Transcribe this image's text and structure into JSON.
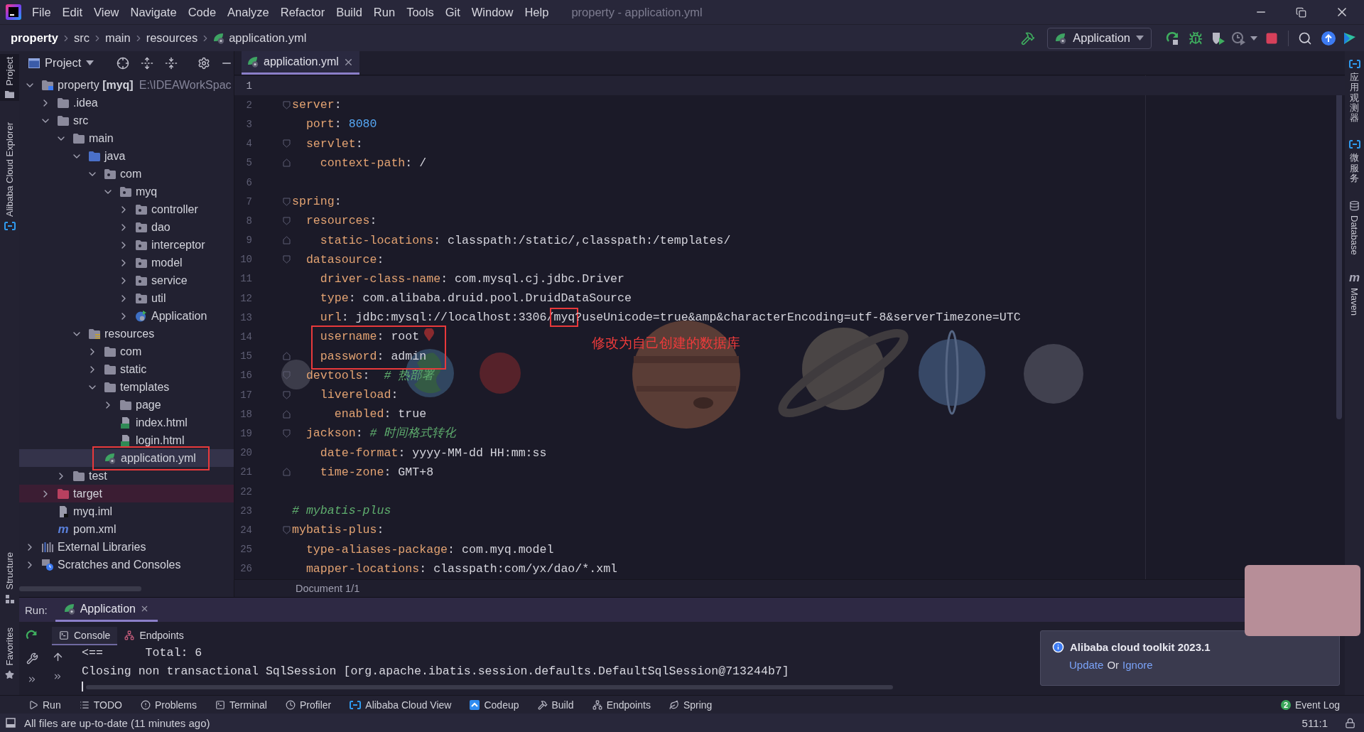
{
  "menu_bar": {
    "items": [
      "File",
      "Edit",
      "View",
      "Navigate",
      "Code",
      "Analyze",
      "Refactor",
      "Build",
      "Run",
      "Tools",
      "Git",
      "Window",
      "Help"
    ],
    "title": "property - application.yml"
  },
  "navigation_bar": {
    "breadcrumbs": [
      {
        "label": "property",
        "kind": "project"
      },
      {
        "label": "src",
        "kind": "folder"
      },
      {
        "label": "main",
        "kind": "folder"
      },
      {
        "label": "resources",
        "kind": "folder"
      },
      {
        "label": "application.yml",
        "kind": "yml"
      }
    ],
    "run_configuration": "Application"
  },
  "left_tool_strip": {
    "top": [
      {
        "label": "Project",
        "kind": "project",
        "selected": true
      },
      {
        "label": "Alibaba Cloud Explorer",
        "kind": "cloud",
        "selected": false
      }
    ],
    "bottom": [
      {
        "label": "Structure",
        "kind": "structure",
        "selected": false
      },
      {
        "label": "Favorites",
        "kind": "favorites",
        "selected": false
      }
    ]
  },
  "right_tool_strip": [
    {
      "label": "应用观测器",
      "kind": "cloud"
    },
    {
      "label": "微服务",
      "kind": "cloud"
    },
    {
      "label": "Database",
      "kind": "database"
    },
    {
      "label": "Maven",
      "kind": "maven",
      "glyph": "m"
    }
  ],
  "project_panel": {
    "title": "Project",
    "tree": [
      {
        "label": "property **[myq]**",
        "path": "E:\\IDEAWorkSpac",
        "kind": "module",
        "expanded": true,
        "selected": false,
        "children": [
          {
            "label": ".idea",
            "kind": "folder",
            "expanded": false,
            "selected": false
          },
          {
            "label": "src",
            "kind": "folder",
            "expanded": true,
            "selected": false,
            "children": [
              {
                "label": "main",
                "kind": "folder",
                "expanded": true,
                "selected": false,
                "children": [
                  {
                    "label": "java",
                    "kind": "source",
                    "expanded": true,
                    "selected": false,
                    "children": [
                      {
                        "label": "com",
                        "kind": "package",
                        "expanded": true,
                        "selected": false,
                        "children": [
                          {
                            "label": "myq",
                            "kind": "package",
                            "expanded": true,
                            "selected": false,
                            "children": [
                              {
                                "label": "controller",
                                "kind": "package",
                                "expanded": false,
                                "selected": false
                              },
                              {
                                "label": "dao",
                                "kind": "package",
                                "expanded": false,
                                "selected": false
                              },
                              {
                                "label": "interceptor",
                                "kind": "package",
                                "expanded": false,
                                "selected": false
                              },
                              {
                                "label": "model",
                                "kind": "package",
                                "expanded": false,
                                "selected": false
                              },
                              {
                                "label": "service",
                                "kind": "package",
                                "expanded": false,
                                "selected": false
                              },
                              {
                                "label": "util",
                                "kind": "package",
                                "expanded": false,
                                "selected": false
                              },
                              {
                                "label": "Application",
                                "kind": "class",
                                "expanded": false,
                                "selected": false
                              }
                            ]
                          }
                        ]
                      }
                    ]
                  },
                  {
                    "label": "resources",
                    "kind": "resources",
                    "expanded": true,
                    "selected": false,
                    "children": [
                      {
                        "label": "com",
                        "kind": "folder",
                        "expanded": false,
                        "selected": false
                      },
                      {
                        "label": "static",
                        "kind": "folder",
                        "expanded": false,
                        "selected": false
                      },
                      {
                        "label": "templates",
                        "kind": "folder",
                        "expanded": true,
                        "selected": false,
                        "children": [
                          {
                            "label": "page",
                            "kind": "folder",
                            "expanded": false,
                            "selected": false
                          },
                          {
                            "label": "index.html",
                            "kind": "html",
                            "selected": false
                          },
                          {
                            "label": "login.html",
                            "kind": "html",
                            "selected": false
                          }
                        ]
                      },
                      {
                        "label": "application.yml",
                        "kind": "yml",
                        "selected": true
                      }
                    ]
                  }
                ]
              },
              {
                "label": "test",
                "kind": "folder",
                "expanded": false,
                "selected": false
              }
            ]
          },
          {
            "label": "target",
            "kind": "excluded",
            "expanded": false,
            "selected": false
          },
          {
            "label": "myq.iml",
            "kind": "iml",
            "selected": false
          },
          {
            "label": "pom.xml",
            "kind": "maven",
            "glyph": "m",
            "selected": false
          }
        ]
      },
      {
        "label": "External Libraries",
        "kind": "libraries",
        "expanded": false,
        "selected": false
      },
      {
        "label": "Scratches and Consoles",
        "kind": "scratches",
        "expanded": false,
        "selected": false
      }
    ]
  },
  "editor": {
    "tabs": [
      {
        "label": "application.yml",
        "kind": "yml",
        "selected": true
      }
    ],
    "lines": [
      {
        "number": "1",
        "current": true
      },
      {
        "number": "2",
        "current": false,
        "fold_start": true,
        "code": [
          {
            "kind": "key",
            "text": "server"
          },
          {
            "kind": "plain",
            "text": ":"
          }
        ]
      },
      {
        "number": "3",
        "current": false,
        "code": [
          {
            "kind": "key",
            "text": "  port"
          },
          {
            "kind": "plain",
            "text": ": "
          },
          {
            "kind": "number",
            "text": "8080"
          }
        ]
      },
      {
        "number": "4",
        "current": false,
        "fold_start": true,
        "code": [
          {
            "kind": "key",
            "text": "  servlet"
          },
          {
            "kind": "plain",
            "text": ":"
          }
        ]
      },
      {
        "number": "5",
        "current": false,
        "fold_end": true,
        "code": [
          {
            "kind": "key",
            "text": "    context-path"
          },
          {
            "kind": "plain",
            "text": ": /"
          }
        ]
      },
      {
        "number": "6",
        "current": false
      },
      {
        "number": "7",
        "current": false,
        "fold_start": true,
        "code": [
          {
            "kind": "key",
            "text": "spring"
          },
          {
            "kind": "plain",
            "text": ":"
          }
        ]
      },
      {
        "number": "8",
        "current": false,
        "fold_start": true,
        "code": [
          {
            "kind": "key",
            "text": "  resources"
          },
          {
            "kind": "plain",
            "text": ":"
          }
        ]
      },
      {
        "number": "9",
        "current": false,
        "fold_end": true,
        "code": [
          {
            "kind": "key",
            "text": "    static-locations"
          },
          {
            "kind": "plain",
            "text": ": classpath:/static/,classpath:/templates/"
          }
        ]
      },
      {
        "number": "10",
        "current": false,
        "fold_start": true,
        "code": [
          {
            "kind": "key",
            "text": "  datasource"
          },
          {
            "kind": "plain",
            "text": ":"
          }
        ]
      },
      {
        "number": "11",
        "current": false,
        "code": [
          {
            "kind": "key",
            "text": "    driver-class-name"
          },
          {
            "kind": "plain",
            "text": ": com.mysql.cj.jdbc.Driver"
          }
        ]
      },
      {
        "number": "12",
        "current": false,
        "code": [
          {
            "kind": "key",
            "text": "    type"
          },
          {
            "kind": "plain",
            "text": ": com.alibaba.druid.pool.DruidDataSource"
          }
        ]
      },
      {
        "number": "13",
        "current": false,
        "code": [
          {
            "kind": "key",
            "text": "    url"
          },
          {
            "kind": "plain",
            "text": ": jdbc:mysql://localhost:3306/"
          },
          {
            "kind": "highlighted",
            "text": "myq"
          },
          {
            "kind": "plain",
            "text": "?useUnicode=true&amp&characterEncoding=utf-8&serverTimezone=UTC"
          }
        ]
      },
      {
        "number": "14",
        "current": false,
        "code": [
          {
            "kind": "key",
            "text": "    username"
          },
          {
            "kind": "plain",
            "text": ": root"
          }
        ]
      },
      {
        "number": "15",
        "current": false,
        "fold_end": true,
        "code": [
          {
            "kind": "key",
            "text": "    password"
          },
          {
            "kind": "plain",
            "text": ": admin"
          }
        ]
      },
      {
        "number": "16",
        "current": false,
        "fold_start": true,
        "code": [
          {
            "kind": "key",
            "text": "  devtools"
          },
          {
            "kind": "plain",
            "text": ":  "
          },
          {
            "kind": "comment",
            "text": "# 热部署"
          }
        ]
      },
      {
        "number": "17",
        "current": false,
        "fold_start": true,
        "code": [
          {
            "kind": "key",
            "text": "    livereload"
          },
          {
            "kind": "plain",
            "text": ":"
          }
        ]
      },
      {
        "number": "18",
        "current": false,
        "fold_end": true,
        "code": [
          {
            "kind": "key",
            "text": "      enabled"
          },
          {
            "kind": "plain",
            "text": ": true"
          }
        ]
      },
      {
        "number": "19",
        "current": false,
        "fold_start": true,
        "code": [
          {
            "kind": "key",
            "text": "  jackson"
          },
          {
            "kind": "plain",
            "text": ": "
          },
          {
            "kind": "comment",
            "text": "# 时间格式转化"
          }
        ]
      },
      {
        "number": "20",
        "current": false,
        "code": [
          {
            "kind": "key",
            "text": "    date-format"
          },
          {
            "kind": "plain",
            "text": ": yyyy-MM-dd HH:mm:ss"
          }
        ]
      },
      {
        "number": "21",
        "current": false,
        "fold_end": true,
        "code": [
          {
            "kind": "key",
            "text": "    time-zone"
          },
          {
            "kind": "plain",
            "text": ": GMT+8"
          }
        ]
      },
      {
        "number": "22",
        "current": false
      },
      {
        "number": "23",
        "current": false,
        "code": [
          {
            "kind": "comment",
            "text": "# mybatis-plus"
          }
        ]
      },
      {
        "number": "24",
        "current": false,
        "fold_start": true,
        "code": [
          {
            "kind": "key",
            "text": "mybatis-plus"
          },
          {
            "kind": "plain",
            "text": ":"
          }
        ]
      },
      {
        "number": "25",
        "current": false,
        "code": [
          {
            "kind": "key",
            "text": "  type-aliases-package"
          },
          {
            "kind": "plain",
            "text": ": com.myq.model"
          }
        ]
      },
      {
        "number": "26",
        "current": false,
        "code": [
          {
            "kind": "key",
            "text": "  mapper-locations"
          },
          {
            "kind": "plain",
            "text": ": classpath:com/yx/dao/*.xml"
          }
        ]
      }
    ],
    "annotation": "修改为自己创建的数据库",
    "status": "Document 1/1"
  },
  "run_panel": {
    "label": "Run:",
    "tabs": [
      {
        "label": "Application",
        "selected": true
      }
    ],
    "subtabs": [
      {
        "label": "Console",
        "kind": "console",
        "selected": true
      },
      {
        "label": "Endpoints",
        "kind": "endpoints",
        "selected": false
      }
    ],
    "output": [
      "<==      Total: 6",
      "Closing non transactional SqlSession [org.apache.ibatis.session.defaults.DefaultSqlSession@713244b7]"
    ]
  },
  "notification": {
    "title": "Alibaba cloud toolkit 2023.1",
    "actions": [
      {
        "kind": "link",
        "text": "Update"
      },
      {
        "kind": "text",
        "text": "Or"
      },
      {
        "kind": "link",
        "text": "Ignore"
      }
    ]
  },
  "tool_window_bar": {
    "items": [
      {
        "label": "Run",
        "kind": "run"
      },
      {
        "label": "TODO",
        "kind": "todo"
      },
      {
        "label": "Problems",
        "kind": "problems"
      },
      {
        "label": "Terminal",
        "kind": "terminal"
      },
      {
        "label": "Profiler",
        "kind": "profiler"
      },
      {
        "label": "Alibaba Cloud View",
        "kind": "cloud"
      },
      {
        "label": "Codeup",
        "kind": "codeup"
      },
      {
        "label": "Build",
        "kind": "build"
      },
      {
        "label": "Endpoints",
        "kind": "endpoints"
      },
      {
        "label": "Spring",
        "kind": "spring"
      }
    ],
    "event_log": {
      "label": "Event Log",
      "count": "2"
    }
  },
  "status_bar": {
    "message": "All files are up-to-date (11 minutes ago)",
    "position": "511:1"
  }
}
